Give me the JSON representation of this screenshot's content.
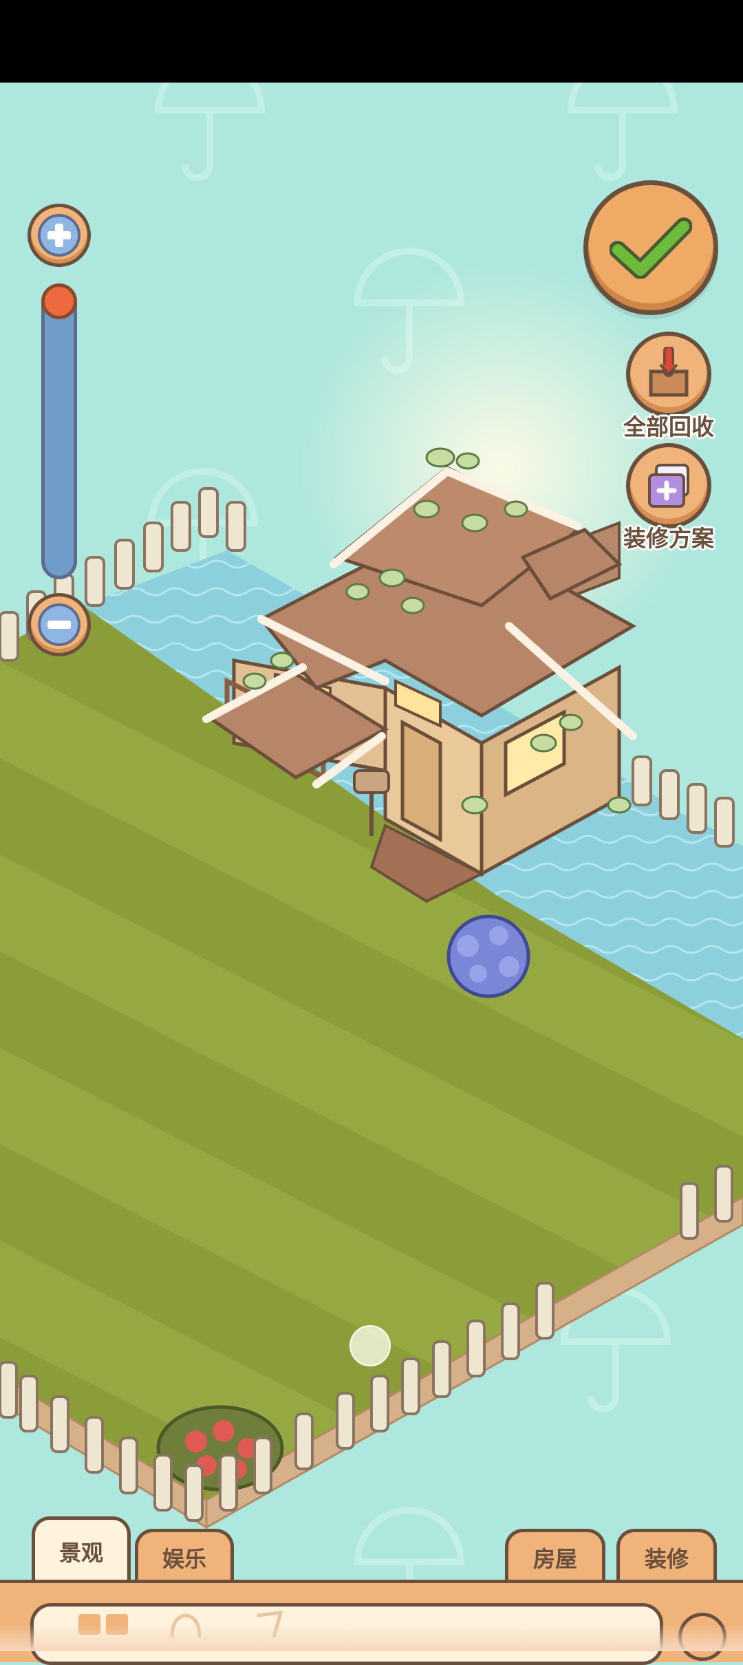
{
  "buttons": {
    "recycle_all_label": "全部回收",
    "renovation_plan_label": "装修方案"
  },
  "tabs": {
    "left": [
      {
        "label": "景观",
        "active": true
      },
      {
        "label": "娱乐",
        "active": false
      }
    ],
    "right": [
      {
        "label": "房屋",
        "active": false
      },
      {
        "label": "装修",
        "active": false
      }
    ]
  },
  "zoom": {
    "level": 0.0
  },
  "icons": [
    "plus-icon",
    "minus-icon",
    "checkmark-icon",
    "recycle-box-icon",
    "renovation-plan-icon"
  ],
  "colors": {
    "background": "#ade7dd",
    "grass_dark": "#8fa23b",
    "grass_light": "#9db048",
    "water": "#8fd3e0",
    "button": "#f0b37a",
    "outline": "#6a4f3d",
    "check": "#6dbb3a"
  }
}
